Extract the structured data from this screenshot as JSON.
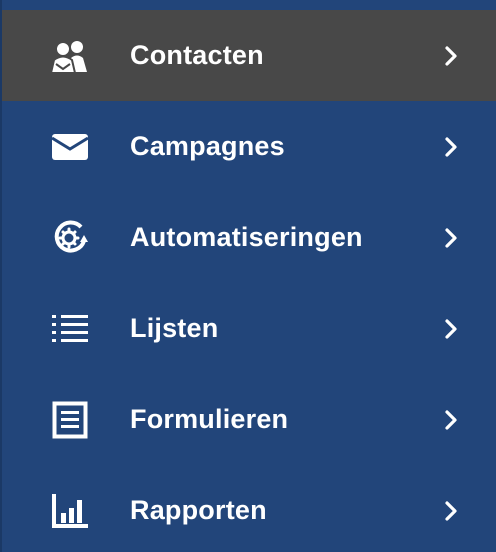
{
  "nav": {
    "items": [
      {
        "label": "Contacten",
        "icon": "contacts-icon",
        "active": true
      },
      {
        "label": "Campagnes",
        "icon": "envelope-icon",
        "active": false
      },
      {
        "label": "Automatiseringen",
        "icon": "automation-gear-icon",
        "active": false
      },
      {
        "label": "Lijsten",
        "icon": "list-icon",
        "active": false
      },
      {
        "label": "Formulieren",
        "icon": "form-icon",
        "active": false
      },
      {
        "label": "Rapporten",
        "icon": "bar-chart-icon",
        "active": false
      }
    ]
  },
  "colors": {
    "background": "#22457a",
    "active_background": "#484848",
    "text": "#ffffff"
  }
}
